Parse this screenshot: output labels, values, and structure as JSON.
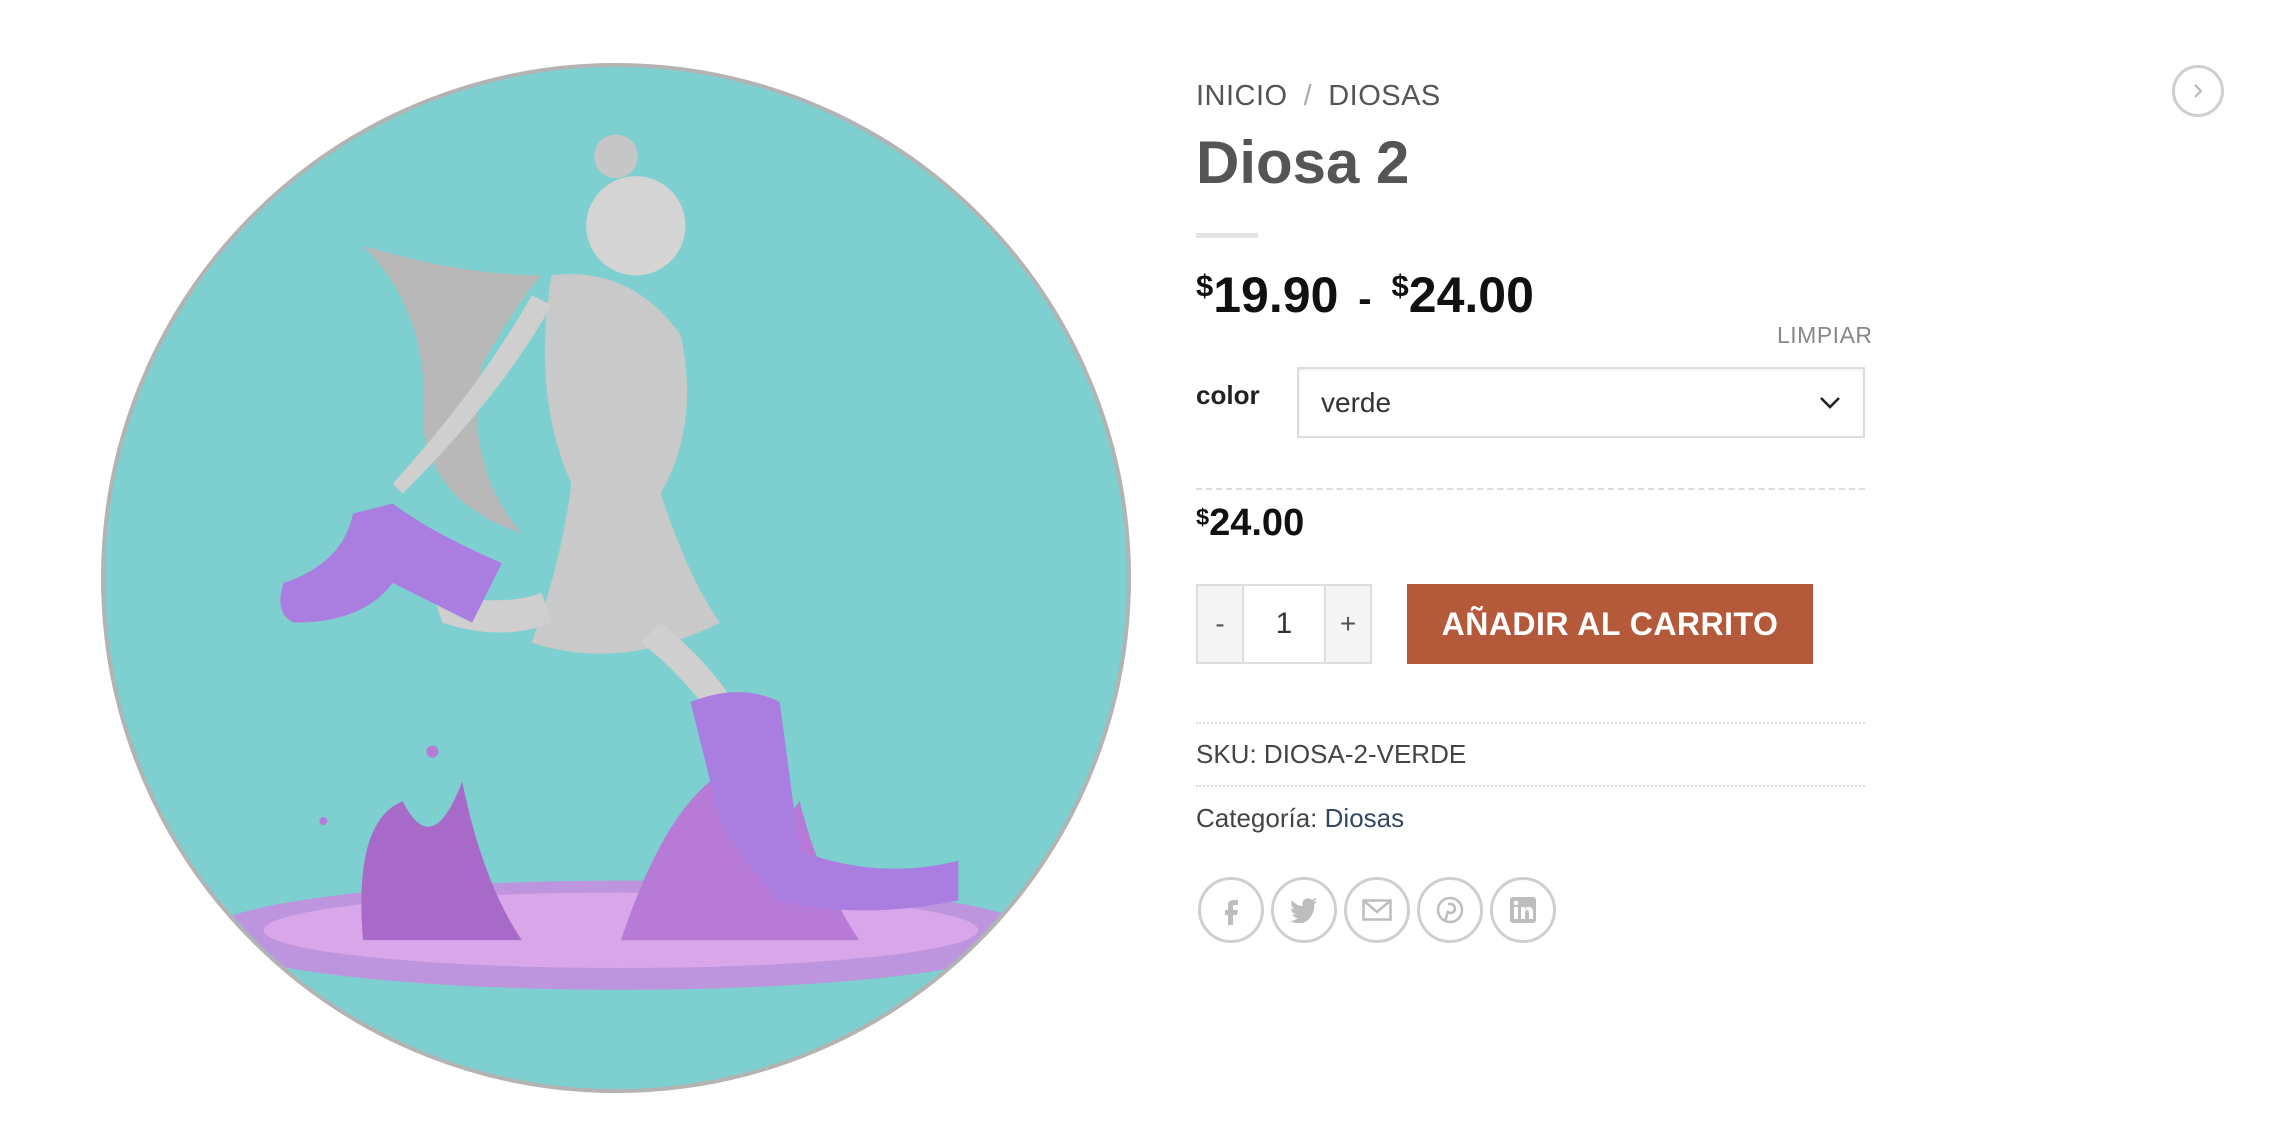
{
  "breadcrumb": {
    "home": "INICIO",
    "separator": "/",
    "category": "DIOSAS"
  },
  "product": {
    "title": "Diosa 2",
    "price_range": {
      "currency": "$",
      "min": "19.90",
      "dash": "-",
      "max": "24.00"
    },
    "variant_price": {
      "currency": "$",
      "amount": "24.00"
    }
  },
  "variations": {
    "clear_label": "LIMPIAR",
    "color_label": "color",
    "color_selected": "verde"
  },
  "cart": {
    "minus_label": "-",
    "quantity": "1",
    "plus_label": "+",
    "add_to_cart_label": "AÑADIR AL CARRITO"
  },
  "meta": {
    "sku_label": "SKU:",
    "sku_value": "DIOSA-2-VERDE",
    "category_label": "Categoría:",
    "category_value": "Diosas"
  },
  "share_icons": [
    "facebook-icon",
    "twitter-icon",
    "email-icon",
    "pinterest-icon",
    "linkedin-icon"
  ],
  "colors": {
    "accent": "#b5593b",
    "image_bg": "#7ecfcf",
    "boots": "#a97ee0"
  }
}
